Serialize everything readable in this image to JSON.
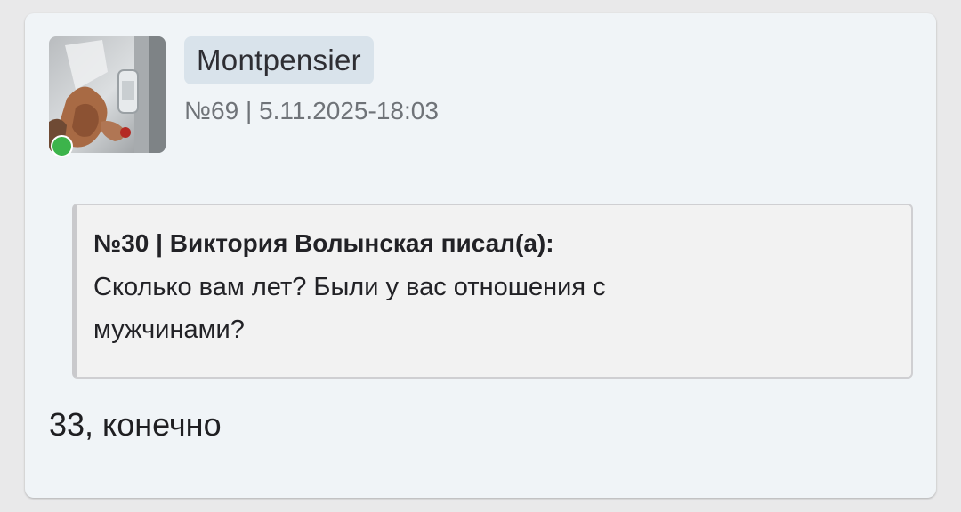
{
  "post": {
    "author": {
      "username": "Montpensier",
      "online_status": "online",
      "online_color": "#3cb44b"
    },
    "meta": "№69 | 5.11.2025-18:03",
    "quote": {
      "header": "№30 | Виктория Волынская писал(а):",
      "text": "Сколько вам лет? Были у вас отношения с мужчинами?"
    },
    "body": "33, конечно"
  }
}
